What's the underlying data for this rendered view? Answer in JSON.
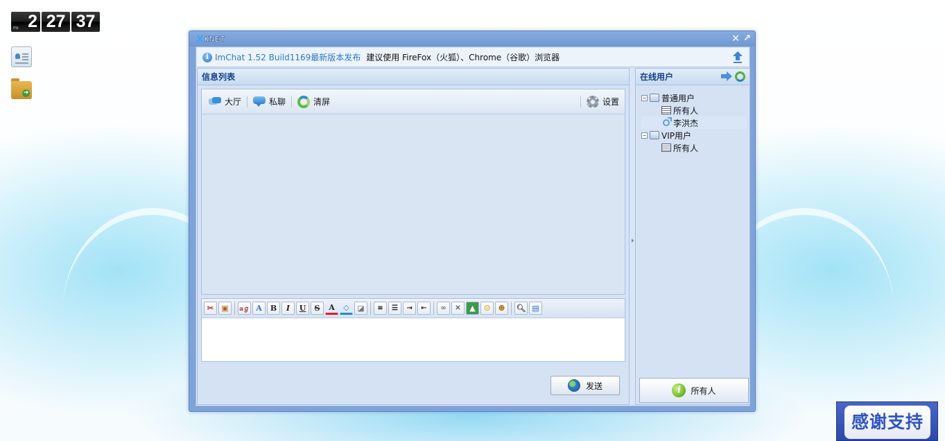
{
  "desktop": {
    "clock": {
      "ampm": "PM",
      "hour": "2",
      "minute": "27",
      "second": "37"
    },
    "icons": [
      "contact-card-icon",
      "folder-icon"
    ],
    "thanks_banner": "感谢支持"
  },
  "window": {
    "logo_mark": "X",
    "logo_text": "KNET",
    "close_symbol": "✕",
    "maximize_symbol": "↗",
    "notice": {
      "link_text": "ImChat 1.52 Build1169最新版本发布",
      "text": "建议使用 FireFox（火狐）、Chrome（谷歌）浏览器"
    },
    "message_panel": {
      "title": "信息列表",
      "toolbar": {
        "hall": "大厅",
        "private_chat": "私聊",
        "clear": "清屏",
        "settings": "设置"
      },
      "editor_toolbar": [
        "cut",
        "paste",
        "spellcheck",
        "font",
        "bold",
        "italic",
        "underline",
        "strikethrough",
        "font-color",
        "highlight",
        "eraser",
        "align-left",
        "bulleted-list",
        "indent",
        "outdent",
        "link",
        "unlink",
        "image",
        "smiley",
        "emoticon",
        "preview",
        "source"
      ],
      "send_label": "发送"
    },
    "users_panel": {
      "title": "在线用户",
      "tree": [
        {
          "label": "普通用户",
          "children": [
            "所有人",
            "李洪杰"
          ]
        },
        {
          "label": "VIP用户",
          "children": [
            "所有人"
          ]
        }
      ],
      "target_label": "所有人"
    }
  }
}
